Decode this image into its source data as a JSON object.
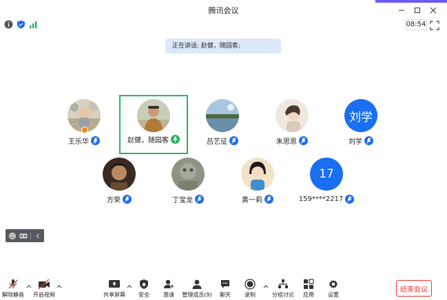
{
  "window": {
    "title": "腾讯会议"
  },
  "status": {
    "timer": "08:54"
  },
  "speaking": {
    "text": "正在讲话: 赵健，随园客;"
  },
  "participants": [
    {
      "name": "王乐华",
      "avatar": "photo-child"
    },
    {
      "name": "赵健，随园客",
      "avatar": "photo-man",
      "active": true
    },
    {
      "name": "吕艺征",
      "avatar": "photo-lake"
    },
    {
      "name": "朱思思",
      "avatar": "photo-girl"
    },
    {
      "name": "刘学",
      "avatar_text": "刘学"
    },
    {
      "name": "方荣",
      "avatar": "photo-dark"
    },
    {
      "name": "丁宝龙",
      "avatar": "photo-statue"
    },
    {
      "name": "黄一莉",
      "avatar": "photo-cartoon"
    },
    {
      "name": "159****2217",
      "avatar_text": "17"
    }
  ],
  "toolbar": {
    "mute": "解除静音",
    "video": "开启视频",
    "share": "共享屏幕",
    "security": "安全",
    "invite": "邀请",
    "members": "管理成员(9)",
    "chat": "聊天",
    "record": "录制",
    "breakout": "分组讨论",
    "apps": "应用",
    "settings": "设置",
    "end": "结束会议"
  },
  "colors": {
    "accent": "#1a6ef0",
    "active_border": "#28b463",
    "end": "#e33333"
  }
}
